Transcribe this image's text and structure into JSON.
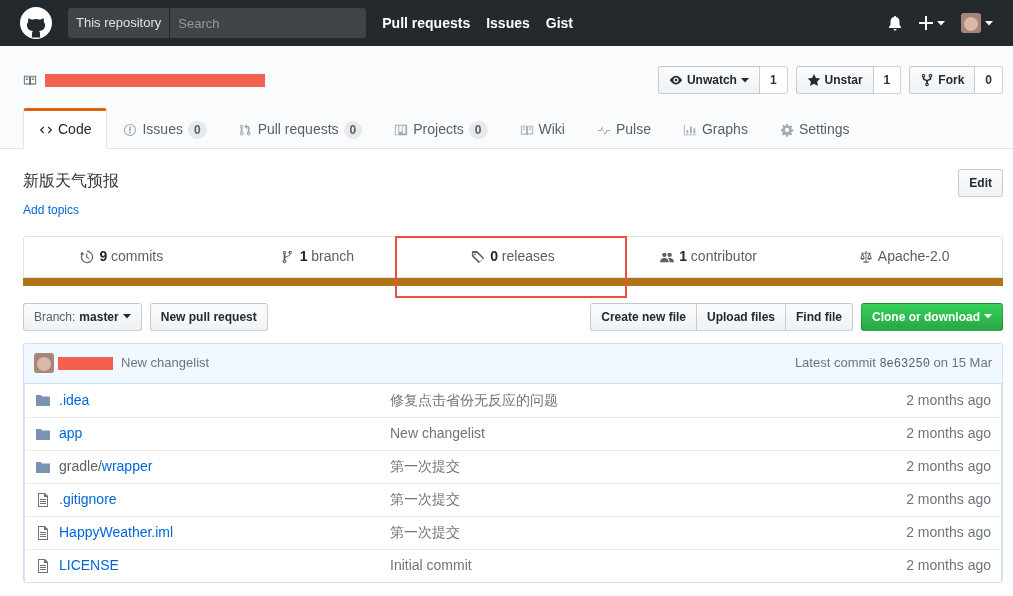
{
  "header": {
    "search_scope": "This repository",
    "search_placeholder": "Search",
    "nav": [
      "Pull requests",
      "Issues",
      "Gist"
    ]
  },
  "repo_actions": [
    {
      "label": "Unwatch",
      "dropdown": true,
      "count": "1"
    },
    {
      "label": "Unstar",
      "dropdown": false,
      "count": "1"
    },
    {
      "label": "Fork",
      "dropdown": false,
      "count": "0"
    }
  ],
  "tabs": [
    {
      "label": "Code",
      "selected": true
    },
    {
      "label": "Issues",
      "counter": "0",
      "selected": false
    },
    {
      "label": "Pull requests",
      "counter": "0",
      "selected": false
    },
    {
      "label": "Projects",
      "counter": "0",
      "selected": false
    },
    {
      "label": "Wiki",
      "selected": false
    },
    {
      "label": "Pulse",
      "selected": false
    },
    {
      "label": "Graphs",
      "selected": false
    },
    {
      "label": "Settings",
      "selected": false
    }
  ],
  "description": "新版天气预报",
  "add_topics": "Add topics",
  "edit_button": "Edit",
  "summary": [
    {
      "count": "9",
      "label": "commits"
    },
    {
      "count": "1",
      "label": "branch"
    },
    {
      "count": "0",
      "label": "releases",
      "highlighted": true
    },
    {
      "count": "1",
      "label": "contributor"
    },
    {
      "label": "Apache-2.0"
    }
  ],
  "language_bar": {
    "color": "#b07219"
  },
  "branch": {
    "label": "Branch:",
    "name": "master"
  },
  "new_pull_request": "New pull request",
  "file_buttons": [
    "Create new file",
    "Upload files",
    "Find file"
  ],
  "clone_button": "Clone or download",
  "commit": {
    "message": "New changelist",
    "latest_label": "Latest commit",
    "sha": "8e63250",
    "date": "on 15 Mar"
  },
  "files": [
    {
      "kind": "dir",
      "name": ".idea",
      "message": "修复点击省份无反应的问题",
      "age": "2 months ago"
    },
    {
      "kind": "dir",
      "name": "app",
      "message": "New changelist",
      "age": "2 months ago"
    },
    {
      "kind": "dir",
      "path": "gradle/",
      "name": "wrapper",
      "message": "第一次提交",
      "age": "2 months ago"
    },
    {
      "kind": "file",
      "name": ".gitignore",
      "message": "第一次提交",
      "age": "2 months ago"
    },
    {
      "kind": "file",
      "name": "HappyWeather.iml",
      "message": "第一次提交",
      "age": "2 months ago"
    },
    {
      "kind": "file",
      "name": "LICENSE",
      "message": "Initial commit",
      "age": "2 months ago"
    }
  ]
}
